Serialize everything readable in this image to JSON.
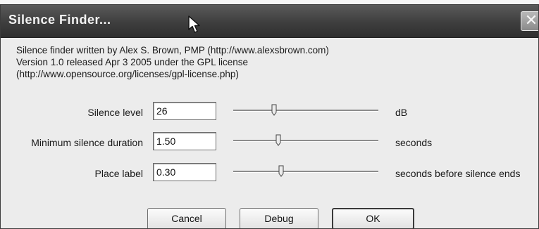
{
  "window": {
    "title": "Silence Finder...",
    "close_label": "✕"
  },
  "description": {
    "line1": "Silence finder written by Alex S. Brown, PMP (http://www.alexsbrown.com)",
    "line2": "Version 1.0 released Apr 3 2005 under the GPL license",
    "line3": "(http://www.opensource.org/licenses/gpl-license.php)"
  },
  "settings": [
    {
      "label": "Silence level",
      "value": "26",
      "unit": "dB",
      "slider_level": 0.28
    },
    {
      "label": "Minimum silence duration",
      "value": "1.50",
      "unit": "seconds",
      "slider_level": 0.31
    },
    {
      "label": "Place label",
      "value": "0.30",
      "unit": "seconds before silence ends",
      "slider_level": 0.33
    }
  ],
  "buttons": {
    "cancel": "Cancel",
    "debug": "Debug",
    "ok": "OK"
  },
  "colors": {
    "titlebar": "#3e3e3e",
    "dialog_bg": "#ececec"
  },
  "icons": {
    "cursor": "mouse-pointer-icon",
    "close": "close-icon"
  }
}
